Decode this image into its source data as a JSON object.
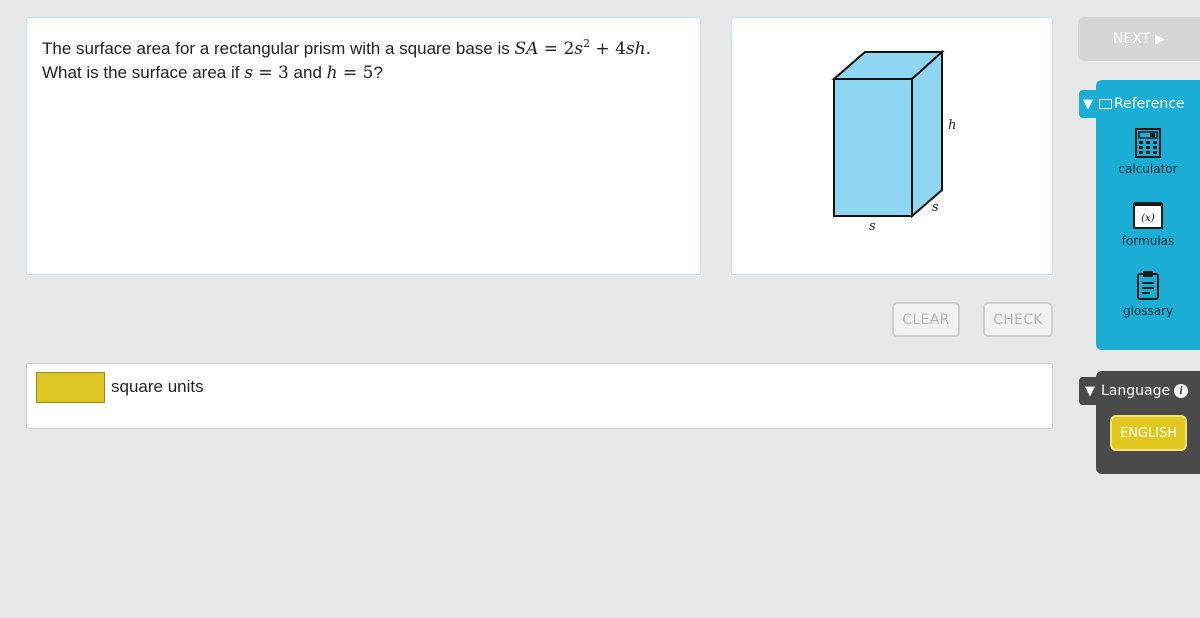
{
  "question": {
    "intro": "The surface area for a rectangular prism with a square base is ",
    "formula_lhs": "SA",
    "formula_eq": " = ",
    "formula_term1_coef": "2",
    "formula_term1_var": "s",
    "formula_term1_exp": "2",
    "formula_plus": " + ",
    "formula_term2_coef": "4",
    "formula_term2_var": "sh",
    "formula_end": ".",
    "line2_start": "What is the surface area if ",
    "var_s": "s",
    "eq1": " = ",
    "val_s": "3",
    "and_text": " and ",
    "var_h": "h",
    "eq2": " = ",
    "val_h": "5",
    "qmark": "?"
  },
  "figure": {
    "label_h": "h",
    "label_s_front": "s",
    "label_s_side": "s",
    "face_color": "#8fd6f2"
  },
  "buttons": {
    "clear": "CLEAR",
    "check": "CHECK",
    "next": "NEXT"
  },
  "answer": {
    "value": "",
    "units": "square units"
  },
  "reference": {
    "title": "Reference",
    "tools": [
      "calculator",
      "formulas",
      "glossary"
    ],
    "formulas_icon_text": "(x)"
  },
  "language": {
    "title": "Language",
    "info": "i",
    "current": "ENGLISH"
  },
  "colors": {
    "accent": "#1aaed4",
    "answer_fill": "#dcc524",
    "language_bg": "#4a4a4a"
  }
}
